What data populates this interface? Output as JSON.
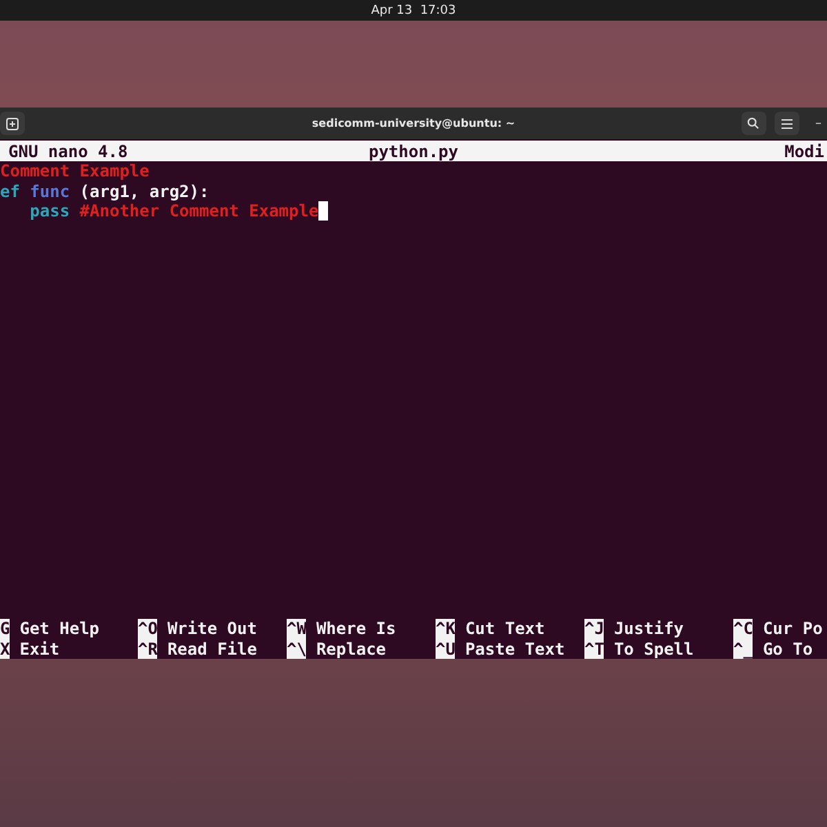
{
  "top_bar": {
    "clock": "Apr 13  17:03"
  },
  "terminal": {
    "title": "sedicomm-university@ubuntu: ~",
    "minimize": "–"
  },
  "nano": {
    "header": {
      "version": "GNU nano 4.8",
      "filename": "python.py",
      "status": "Modi"
    },
    "lines": [
      {
        "segments": [
          {
            "kind": "comment",
            "text": "Comment Example"
          }
        ]
      },
      {
        "segments": [
          {
            "kind": "keyword",
            "text": "ef"
          },
          {
            "kind": "function",
            "text": " func"
          },
          {
            "kind": "plain",
            "text": " (arg1, arg2):"
          }
        ]
      },
      {
        "segments": [
          {
            "kind": "keyword",
            "text": "   pass"
          },
          {
            "kind": "comment",
            "text": " #Another Comment Example"
          }
        ],
        "cursor": true
      }
    ],
    "shortcuts": [
      [
        {
          "key": "G",
          "label": "Get Help"
        },
        {
          "key": "^O",
          "label": "Write Out"
        },
        {
          "key": "^W",
          "label": "Where Is"
        },
        {
          "key": "^K",
          "label": "Cut Text"
        },
        {
          "key": "^J",
          "label": "Justify"
        },
        {
          "key": "^C",
          "label": "Cur Po"
        }
      ],
      [
        {
          "key": "X",
          "label": "Exit"
        },
        {
          "key": "^R",
          "label": "Read File"
        },
        {
          "key": "^\\",
          "label": "Replace"
        },
        {
          "key": "^U",
          "label": "Paste Text"
        },
        {
          "key": "^T",
          "label": "To Spell"
        },
        {
          "key": "^_",
          "label": "Go To"
        }
      ]
    ]
  }
}
